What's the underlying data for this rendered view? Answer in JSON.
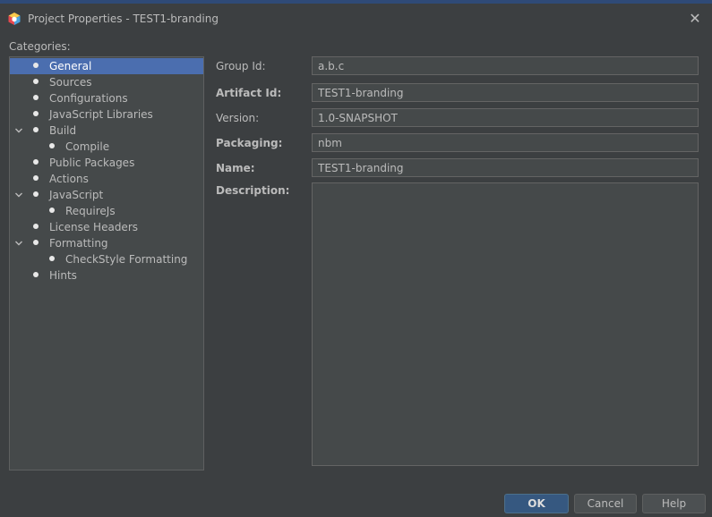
{
  "window": {
    "title": "Project Properties - TEST1-branding",
    "close_symbol": "✕"
  },
  "categories": {
    "label": "Categories:",
    "items": [
      {
        "label": "General",
        "level": 0,
        "selected": true,
        "expanded": null
      },
      {
        "label": "Sources",
        "level": 0,
        "selected": false,
        "expanded": null
      },
      {
        "label": "Configurations",
        "level": 0,
        "selected": false,
        "expanded": null
      },
      {
        "label": "JavaScript Libraries",
        "level": 0,
        "selected": false,
        "expanded": null
      },
      {
        "label": "Build",
        "level": 0,
        "selected": false,
        "expanded": true
      },
      {
        "label": "Compile",
        "level": 1,
        "selected": false,
        "expanded": null
      },
      {
        "label": "Public Packages",
        "level": 0,
        "selected": false,
        "expanded": null
      },
      {
        "label": "Actions",
        "level": 0,
        "selected": false,
        "expanded": null
      },
      {
        "label": "JavaScript",
        "level": 0,
        "selected": false,
        "expanded": true
      },
      {
        "label": "RequireJs",
        "level": 1,
        "selected": false,
        "expanded": null
      },
      {
        "label": "License Headers",
        "level": 0,
        "selected": false,
        "expanded": null
      },
      {
        "label": "Formatting",
        "level": 0,
        "selected": false,
        "expanded": true
      },
      {
        "label": "CheckStyle Formatting",
        "level": 1,
        "selected": false,
        "expanded": null
      },
      {
        "label": "Hints",
        "level": 0,
        "selected": false,
        "expanded": null
      }
    ]
  },
  "form": {
    "group_id": {
      "label": "Group Id:",
      "value": "a.b.c"
    },
    "artifact_id": {
      "label": "Artifact Id:",
      "value": "TEST1-branding"
    },
    "version": {
      "label": "Version:",
      "value": "1.0-SNAPSHOT"
    },
    "packaging": {
      "label": "Packaging:",
      "value": "nbm"
    },
    "name": {
      "label": "Name:",
      "value": "TEST1-branding"
    },
    "description": {
      "label": "Description:",
      "value": ""
    }
  },
  "buttons": {
    "ok": "OK",
    "cancel": "Cancel",
    "help": "Help"
  },
  "colors": {
    "background": "#3c3f41",
    "selection": "#4b6eaf",
    "primary_button": "#365880"
  },
  "icons": {
    "app": "netbeans-cube-icon",
    "expand": "chevron-down-icon",
    "bullet": "bullet-icon",
    "close": "close-icon"
  }
}
